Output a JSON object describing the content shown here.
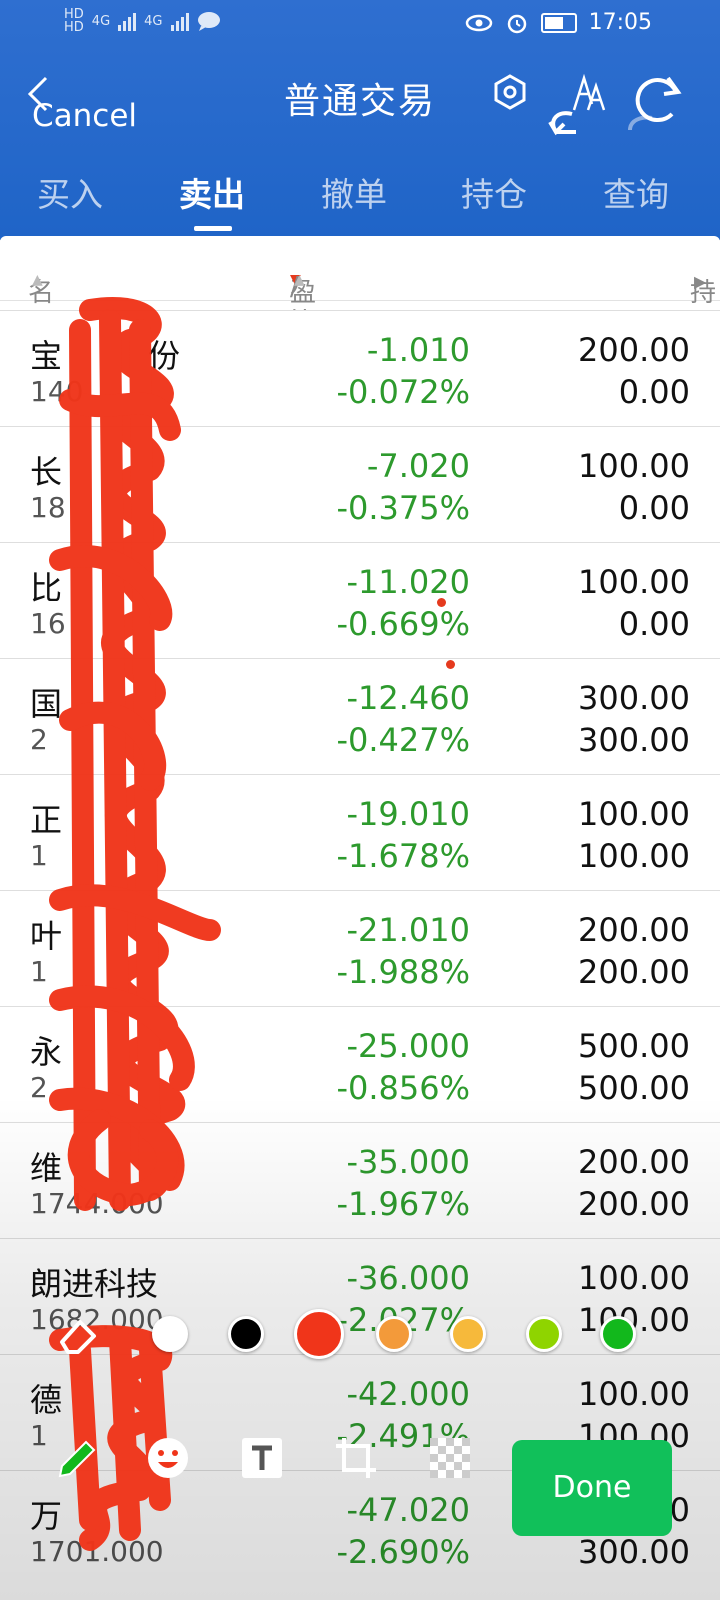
{
  "status_bar": {
    "sim1": "HD",
    "sim2": "HD",
    "net1": "4G",
    "net2": "4G",
    "time": "17:05"
  },
  "nav": {
    "title": "普通交易",
    "cancel_label": "Cancel"
  },
  "tabs": [
    {
      "label": "买入"
    },
    {
      "label": "卖出"
    },
    {
      "label": "撤单"
    },
    {
      "label": "持仓"
    },
    {
      "label": "查询"
    }
  ],
  "active_tab": "卖出",
  "table": {
    "headers": {
      "name_value": "名称/市值",
      "pl_ratio": "盈亏",
      "pl_ratio2": "/比例",
      "position": "持仓/可用"
    },
    "rows": [
      {
        "name": "宝",
        "name2": "份",
        "market_value": "140",
        "pl": "-1.010",
        "pct": "-0.072%",
        "position": "200.00",
        "available": "0.00"
      },
      {
        "name": "长",
        "name2": "",
        "market_value": "18",
        "pl": "-7.020",
        "pct": "-0.375%",
        "position": "100.00",
        "available": "0.00"
      },
      {
        "name": "比",
        "name2": "",
        "market_value": "16",
        "pl": "-11.020",
        "pct": "-0.669%",
        "position": "100.00",
        "available": "0.00"
      },
      {
        "name": "国",
        "name2": "",
        "market_value": "2",
        "pl": "-12.460",
        "pct": "-0.427%",
        "position": "300.00",
        "available": "300.00"
      },
      {
        "name": "正",
        "name2": "",
        "market_value": "1",
        "pl": "-19.010",
        "pct": "-1.678%",
        "position": "100.00",
        "available": "100.00"
      },
      {
        "name": "叶",
        "name2": "",
        "market_value": "1",
        "pl": "-21.010",
        "pct": "-1.988%",
        "position": "200.00",
        "available": "200.00"
      },
      {
        "name": "永",
        "name2": "",
        "market_value": "2",
        "pl": "-25.000",
        "pct": "-0.856%",
        "position": "500.00",
        "available": "500.00"
      },
      {
        "name": "维",
        "name2": "",
        "market_value": "1744.000",
        "pl": "-35.000",
        "pct": "-1.967%",
        "position": "200.00",
        "available": "200.00"
      },
      {
        "name": "朗进科技",
        "name2": "",
        "market_value": "1682.000",
        "pl": "-36.000",
        "pct": "-2.027%",
        "position": "100.00",
        "available": "100.00"
      },
      {
        "name": "德",
        "name2": "",
        "market_value": "1",
        "pl": "-42.000",
        "pct": "-2.491%",
        "position": "100.00",
        "available": "100.00"
      },
      {
        "name": "万",
        "name2": "",
        "market_value": "1701.000",
        "pl": "-47.020",
        "pct": "-2.690%",
        "position": "300.00",
        "available": "300.00"
      }
    ]
  },
  "editor": {
    "colors": [
      "#ffffff",
      "#000000",
      "#f0351a",
      "#f39a3a",
      "#f6b93b",
      "#8fd400",
      "#12b81c"
    ],
    "selected_color": "#f0351a",
    "done_label": "Done"
  },
  "colors": {
    "header_blue": "#2a6bce",
    "loss_green": "#2d9a2d",
    "done_green": "#11c05a",
    "scribble_red": "#f0351a"
  }
}
